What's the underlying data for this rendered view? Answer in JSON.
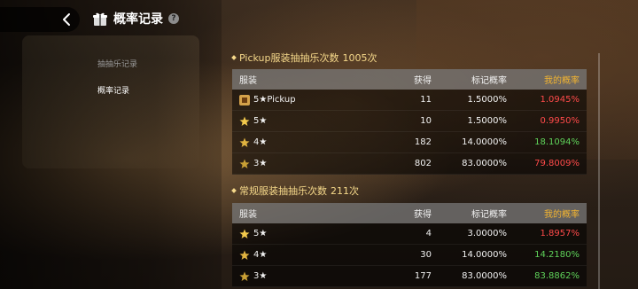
{
  "header": {
    "title": "概率记录",
    "help": "?"
  },
  "tabs": [
    {
      "label": "抽抽乐记录"
    },
    {
      "label": "概率记录"
    }
  ],
  "pickup_section": {
    "title_prefix": "Pickup服装抽抽乐次数",
    "count": "1005次",
    "columns": [
      "服装",
      "获得",
      "标记概率",
      "我的概率"
    ],
    "rows": [
      {
        "tier": "5★Pickup",
        "obtained": "11",
        "marked": "1.5000%",
        "mine": "1.0945%",
        "mine_color": "red",
        "icon": "pickup-icon"
      },
      {
        "tier": "5★",
        "obtained": "10",
        "marked": "1.5000%",
        "mine": "0.9950%",
        "mine_color": "red",
        "icon": "star-5-icon"
      },
      {
        "tier": "4★",
        "obtained": "182",
        "marked": "14.0000%",
        "mine": "18.1094%",
        "mine_color": "green",
        "icon": "star-4-icon"
      },
      {
        "tier": "3★",
        "obtained": "802",
        "marked": "83.0000%",
        "mine": "79.8009%",
        "mine_color": "red",
        "icon": "star-3-icon"
      }
    ]
  },
  "regular_section": {
    "title_prefix": "常规服装抽抽乐次数",
    "count": "211次",
    "columns": [
      "服装",
      "获得",
      "标记概率",
      "我的概率"
    ],
    "rows": [
      {
        "tier": "5★",
        "obtained": "4",
        "marked": "3.0000%",
        "mine": "1.8957%",
        "mine_color": "red",
        "icon": "star-5-icon"
      },
      {
        "tier": "4★",
        "obtained": "30",
        "marked": "14.0000%",
        "mine": "14.2180%",
        "mine_color": "green",
        "icon": "star-4-icon"
      },
      {
        "tier": "3★",
        "obtained": "177",
        "marked": "83.0000%",
        "mine": "83.8862%",
        "mine_color": "green",
        "icon": "star-3-icon"
      }
    ]
  },
  "colors": {
    "accent": "#f5d88a",
    "red": "#ff4a4a",
    "green": "#5fd35a",
    "my_rate_header": "#f2b431"
  }
}
